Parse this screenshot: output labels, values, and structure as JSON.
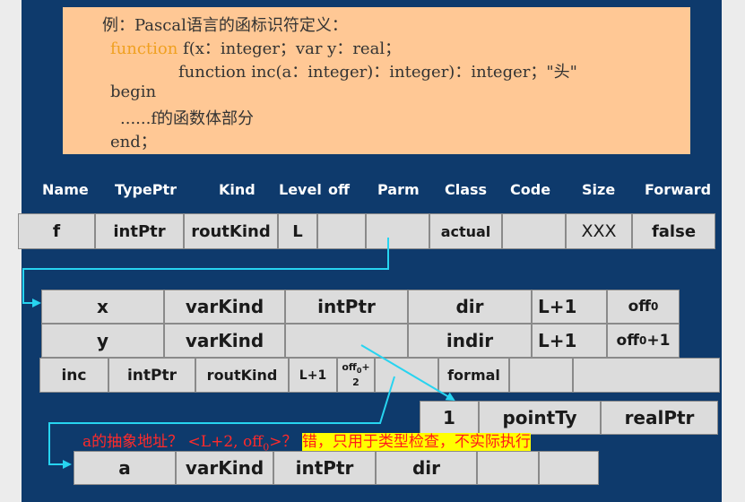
{
  "code": {
    "line1": "例：Pascal语言的函标识符定义：",
    "line2_kw": "function",
    "line2_rest": " f(x：integer；var y：real；",
    "line3": "function inc(a：integer)：integer)：integer；\"头\"",
    "line4": "begin",
    "line5": "......f的函数体部分",
    "line6": "end；"
  },
  "headers": [
    "Name",
    "TypePtr",
    "Kind",
    "Level",
    "off",
    "Parm",
    "Class",
    "Code",
    "Size",
    "Forward"
  ],
  "row_f": [
    "f",
    "intPtr",
    "routKind",
    "L",
    "",
    "",
    "actual",
    "",
    "XXX",
    "false"
  ],
  "row_x": [
    "x",
    "varKind",
    "intPtr",
    "dir",
    "L+1"
  ],
  "row_x_off": "off",
  "row_x_off_sub": "0",
  "row_y": [
    "y",
    "varKind",
    "",
    "indir",
    "L+1"
  ],
  "row_y_off": "off",
  "row_y_off_sub": "0",
  "row_y_off_tail": "+1",
  "row_inc": [
    "inc",
    "intPtr",
    "routKind",
    "L+1",
    "",
    "formal",
    "",
    ""
  ],
  "row_inc_off_a": "off",
  "row_inc_off_sub": "0",
  "row_inc_off_b": "+",
  "row_inc_off_c": "2",
  "row_type": [
    "1",
    "pointTy",
    "realPtr"
  ],
  "row_a": [
    "a",
    "varKind",
    "intPtr",
    "dir",
    "",
    ""
  ],
  "annotation": {
    "question": "a的抽象地址？ <L+2, off",
    "question_sub": "0",
    "question_end": ">？",
    "answer": "错，只用于类型检查，不实际执行"
  },
  "colors": {
    "background": "#0e3a6c",
    "code_box": "#ffc895",
    "cell": "#dcdcdc",
    "arrow": "#27d4f0",
    "keyword": "#f0a020"
  }
}
